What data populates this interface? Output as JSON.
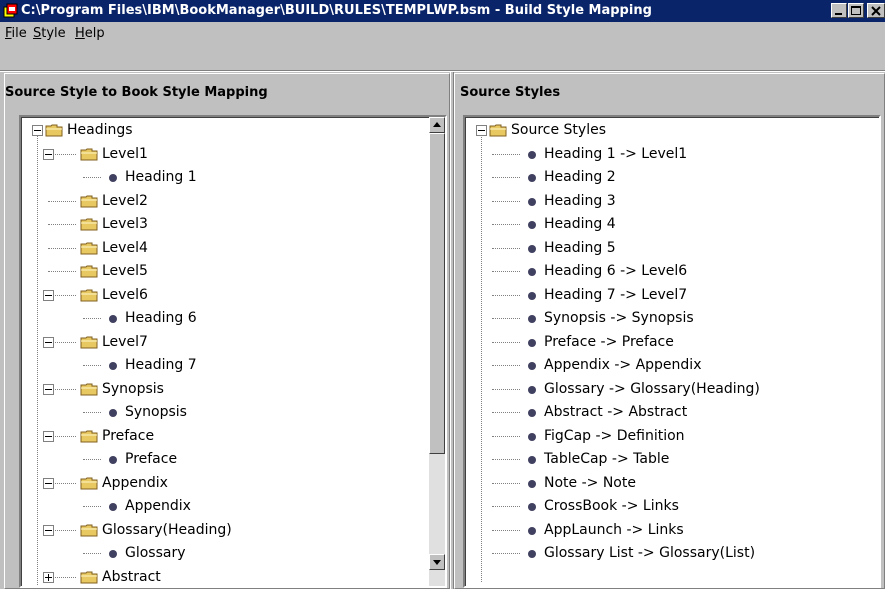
{
  "window": {
    "title": "C:\\Program Files\\IBM\\BookManager\\BUILD\\RULES\\TEMPLWP.bsm - Build Style Mapping",
    "app_icon": "bookmanager-app-icon"
  },
  "menubar": {
    "items": [
      {
        "label": "File",
        "mnemonic": "F",
        "rest": "ile"
      },
      {
        "label": "Style",
        "mnemonic": "S",
        "rest": "tyle"
      },
      {
        "label": "Help",
        "mnemonic": "H",
        "rest": "elp"
      }
    ]
  },
  "left_panel": {
    "title": "Source Style to Book Style Mapping",
    "tree": [
      {
        "label": "Headings",
        "type": "folder",
        "level": 0,
        "expander": "minus"
      },
      {
        "label": "Level1",
        "type": "folder",
        "level": 1,
        "expander": "minus"
      },
      {
        "label": "Heading 1",
        "type": "leaf",
        "level": 2
      },
      {
        "label": "Level2",
        "type": "folder",
        "level": 1
      },
      {
        "label": "Level3",
        "type": "folder",
        "level": 1
      },
      {
        "label": "Level4",
        "type": "folder",
        "level": 1
      },
      {
        "label": "Level5",
        "type": "folder",
        "level": 1
      },
      {
        "label": "Level6",
        "type": "folder",
        "level": 1,
        "expander": "minus"
      },
      {
        "label": "Heading 6",
        "type": "leaf",
        "level": 2
      },
      {
        "label": "Level7",
        "type": "folder",
        "level": 1,
        "expander": "minus"
      },
      {
        "label": "Heading 7",
        "type": "leaf",
        "level": 2
      },
      {
        "label": "Synopsis",
        "type": "folder",
        "level": 1,
        "expander": "minus"
      },
      {
        "label": "Synopsis",
        "type": "leaf",
        "level": 2
      },
      {
        "label": "Preface",
        "type": "folder",
        "level": 1,
        "expander": "minus"
      },
      {
        "label": "Preface",
        "type": "leaf",
        "level": 2
      },
      {
        "label": "Appendix",
        "type": "folder",
        "level": 1,
        "expander": "minus"
      },
      {
        "label": "Appendix",
        "type": "leaf",
        "level": 2
      },
      {
        "label": "Glossary(Heading)",
        "type": "folder",
        "level": 1,
        "expander": "minus"
      },
      {
        "label": "Glossary",
        "type": "leaf",
        "level": 2
      },
      {
        "label": "Abstract",
        "type": "folder",
        "level": 1,
        "expander": "plus"
      }
    ]
  },
  "right_panel": {
    "title": "Source Styles",
    "tree": [
      {
        "label": "Source Styles",
        "type": "folder",
        "level": 0,
        "expander": "minus"
      },
      {
        "label": "Heading 1 -> Level1",
        "type": "leaf",
        "level": 1
      },
      {
        "label": "Heading 2",
        "type": "leaf",
        "level": 1
      },
      {
        "label": "Heading 3",
        "type": "leaf",
        "level": 1
      },
      {
        "label": "Heading 4",
        "type": "leaf",
        "level": 1
      },
      {
        "label": "Heading 5",
        "type": "leaf",
        "level": 1
      },
      {
        "label": "Heading 6 -> Level6",
        "type": "leaf",
        "level": 1
      },
      {
        "label": "Heading 7 -> Level7",
        "type": "leaf",
        "level": 1
      },
      {
        "label": "Synopsis -> Synopsis",
        "type": "leaf",
        "level": 1
      },
      {
        "label": "Preface -> Preface",
        "type": "leaf",
        "level": 1
      },
      {
        "label": "Appendix -> Appendix",
        "type": "leaf",
        "level": 1
      },
      {
        "label": "Glossary -> Glossary(Heading)",
        "type": "leaf",
        "level": 1
      },
      {
        "label": "Abstract -> Abstract",
        "type": "leaf",
        "level": 1
      },
      {
        "label": "FigCap -> Definition",
        "type": "leaf",
        "level": 1
      },
      {
        "label": "TableCap -> Table",
        "type": "leaf",
        "level": 1
      },
      {
        "label": "Note -> Note",
        "type": "leaf",
        "level": 1
      },
      {
        "label": "CrossBook -> Links",
        "type": "leaf",
        "level": 1
      },
      {
        "label": "AppLaunch -> Links",
        "type": "leaf",
        "level": 1
      },
      {
        "label": "Glossary List -> Glossary(List)",
        "type": "leaf",
        "level": 1
      }
    ]
  },
  "colors": {
    "titlebar": "#0a246a",
    "window_bg": "#c0c0c0",
    "tree_bg": "#ffffff",
    "folder": "#e8c860",
    "bullet": "#404060"
  },
  "icons": {
    "folder": "folder-icon",
    "leaf": "bullet-icon",
    "expand": "expand-icon",
    "collapse": "collapse-icon"
  }
}
